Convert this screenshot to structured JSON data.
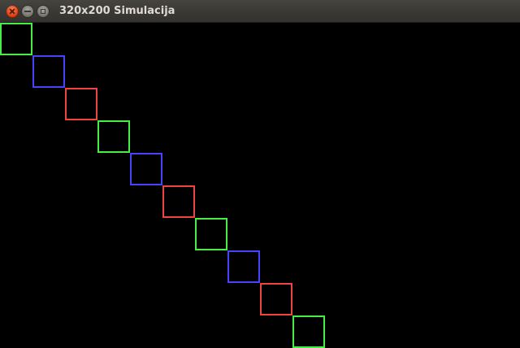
{
  "window": {
    "title": "320x200 Simulacija",
    "buttons": {
      "close": "close-icon",
      "minimize": "minimize-icon",
      "maximize": "maximize-icon"
    }
  },
  "canvas": {
    "background": "#000000",
    "square_colors": [
      "#44ee44",
      "#4444ff",
      "#ee4444",
      "#44ee44",
      "#4444ff",
      "#ee4444",
      "#44ee44",
      "#4444ff",
      "#ee4444",
      "#44ee44"
    ]
  }
}
